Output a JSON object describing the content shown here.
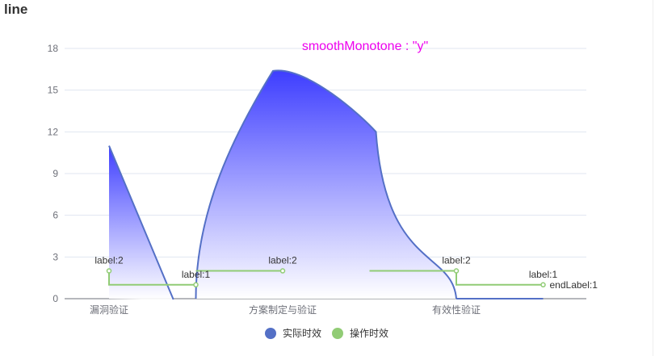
{
  "page": {
    "title": "line"
  },
  "chart_data": {
    "type": "line",
    "title": "smoothMonotone : \"y\"",
    "title_color": "#ee00ee",
    "categories": [
      "漏洞验证",
      "方案制定与验证",
      "有效性验证"
    ],
    "y_ticks": [
      0,
      3,
      6,
      9,
      12,
      15,
      18
    ],
    "ylim": [
      0,
      18
    ],
    "grid": true,
    "legend_position": "bottom",
    "series": [
      {
        "name": "实际时效",
        "type": "line",
        "smooth": true,
        "smooth_monotone": "y",
        "area": true,
        "color": "#5470c6",
        "area_gradient": [
          "#3333ff",
          "#ffffff"
        ],
        "points": [
          [
            0.0,
            11
          ],
          [
            0.38,
            0
          ],
          [
            0.5,
            0
          ],
          [
            1.0,
            16.5
          ],
          [
            1.5,
            12
          ],
          [
            2.0,
            0
          ],
          [
            2.5,
            0
          ]
        ]
      },
      {
        "name": "操作时效",
        "type": "line",
        "step": true,
        "color": "#91cc75",
        "segments": [
          [
            [
              0.0,
              2
            ],
            [
              0.5,
              1
            ]
          ],
          [
            [
              0.5,
              2
            ],
            [
              1.0,
              2
            ]
          ],
          [
            [
              1.5,
              2
            ],
            [
              2.0,
              2
            ],
            [
              2.5,
              1
            ]
          ]
        ],
        "labels": [
          {
            "x": 0.0,
            "y": 2,
            "text": "label:2"
          },
          {
            "x": 0.5,
            "y": 1,
            "text": "label:1"
          },
          {
            "x": 1.0,
            "y": 2,
            "text": "label:2"
          },
          {
            "x": 2.0,
            "y": 2,
            "text": "label:2"
          },
          {
            "x": 2.5,
            "y": 1,
            "text": "label:1"
          }
        ],
        "end_label": "endLabel:1"
      }
    ]
  }
}
